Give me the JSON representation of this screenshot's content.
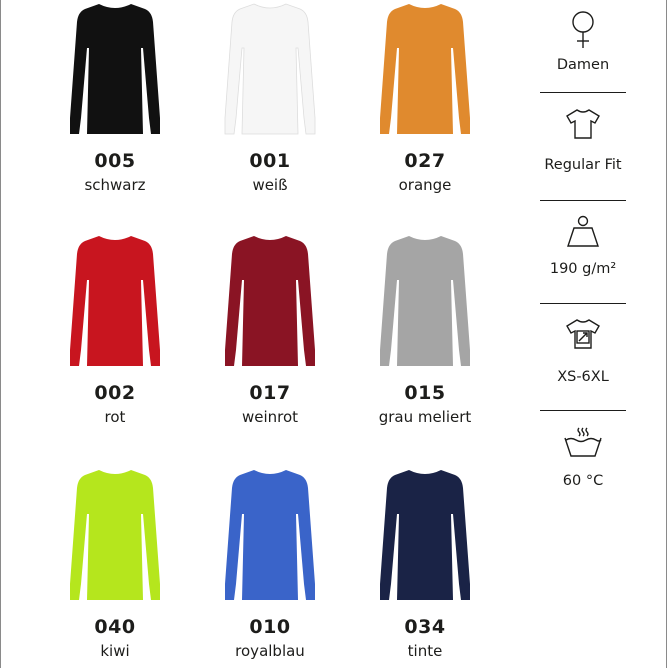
{
  "colors": [
    {
      "code": "005",
      "name": "schwarz",
      "hex": "#111111"
    },
    {
      "code": "001",
      "name": "weiß",
      "hex": "#f6f6f6"
    },
    {
      "code": "027",
      "name": "orange",
      "hex": "#e08a2e"
    },
    {
      "code": "002",
      "name": "rot",
      "hex": "#c8151f"
    },
    {
      "code": "017",
      "name": "weinrot",
      "hex": "#8a1424"
    },
    {
      "code": "015",
      "name": "grau meliert",
      "hex": "#a5a5a5"
    },
    {
      "code": "040",
      "name": "kiwi",
      "hex": "#b5e61d"
    },
    {
      "code": "010",
      "name": "royalblau",
      "hex": "#3a64c9"
    },
    {
      "code": "034",
      "name": "tinte",
      "hex": "#1a2346"
    }
  ],
  "features": [
    {
      "icon": "female-symbol-icon",
      "label": "Damen"
    },
    {
      "icon": "tshirt-fit-icon",
      "label": "Regular Fit"
    },
    {
      "icon": "weight-icon",
      "label": "190 g/m²"
    },
    {
      "icon": "size-range-icon",
      "label": "XS-6XL"
    },
    {
      "icon": "wash-60-icon",
      "label": "60 °C"
    }
  ]
}
